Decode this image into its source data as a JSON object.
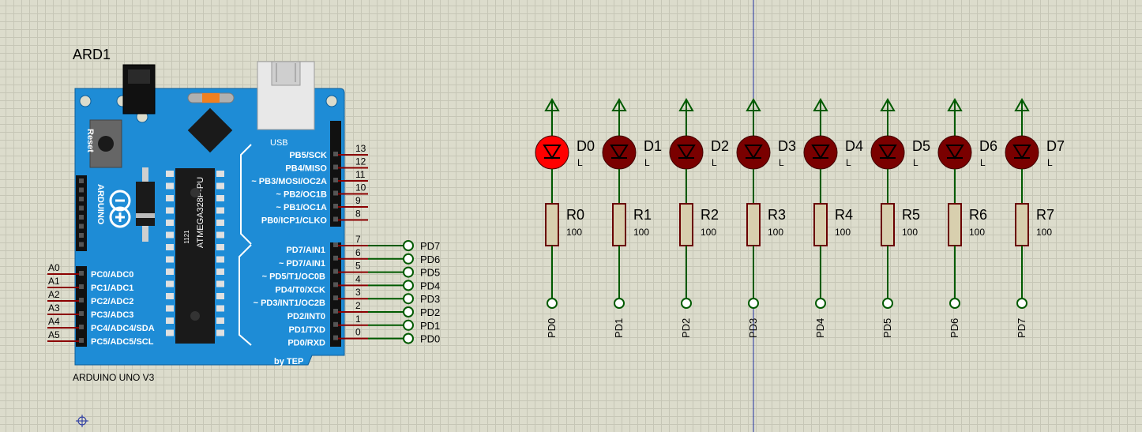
{
  "arduino": {
    "ref": "ARD1",
    "name": "ARDUINO UNO V3",
    "usb_label": "USB",
    "reset_label": "Reset",
    "logo_text": "ARDUINO",
    "chip_label": "ATMEGA328P-PU",
    "chip_code": "1121",
    "by_label": "by TEP",
    "digital_upper": [
      {
        "num": "13",
        "label": "PB5/SCK"
      },
      {
        "num": "12",
        "label": "PB4/MISO"
      },
      {
        "num": "11",
        "label": "~ PB3/MOSI/OC2A"
      },
      {
        "num": "10",
        "label": "~ PB2/OC1B"
      },
      {
        "num": "9",
        "label": "~ PB1/OC1A"
      },
      {
        "num": "8",
        "label": "PB0/ICP1/CLKO"
      }
    ],
    "digital_lower": [
      {
        "num": "7",
        "label": "PD7/AIN1"
      },
      {
        "num": "6",
        "label": "~ PD7/AIN1"
      },
      {
        "num": "5",
        "label": "~ PD5/T1/OC0B"
      },
      {
        "num": "4",
        "label": "PD4/T0/XCK"
      },
      {
        "num": "3",
        "label": "~ PD3/INT1/OC2B"
      },
      {
        "num": "2",
        "label": "PD2/INT0"
      },
      {
        "num": "1",
        "label": "PD1/TXD"
      },
      {
        "num": "0",
        "label": "PD0/RXD"
      }
    ],
    "analog": [
      {
        "ext": "A0",
        "label": "PC0/ADC0"
      },
      {
        "ext": "A1",
        "label": "PC1/ADC1"
      },
      {
        "ext": "A2",
        "label": "PC2/ADC2"
      },
      {
        "ext": "A3",
        "label": "PC3/ADC3"
      },
      {
        "ext": "A4",
        "label": "PC4/ADC4/SDA"
      },
      {
        "ext": "A5",
        "label": "PC5/ADC5/SCL"
      }
    ]
  },
  "board_terminals": [
    "PD7",
    "PD6",
    "PD5",
    "PD4",
    "PD3",
    "PD2",
    "PD1",
    "PD0"
  ],
  "leds": [
    {
      "ref": "D0",
      "type": "L",
      "resistor": "R0",
      "value": "100",
      "net": "PD0",
      "lit": true
    },
    {
      "ref": "D1",
      "type": "L",
      "resistor": "R1",
      "value": "100",
      "net": "PD1",
      "lit": false
    },
    {
      "ref": "D2",
      "type": "L",
      "resistor": "R2",
      "value": "100",
      "net": "PD2",
      "lit": false
    },
    {
      "ref": "D3",
      "type": "L",
      "resistor": "R3",
      "value": "100",
      "net": "PD3",
      "lit": false
    },
    {
      "ref": "D4",
      "type": "L",
      "resistor": "R4",
      "value": "100",
      "net": "PD4",
      "lit": false
    },
    {
      "ref": "D5",
      "type": "L",
      "resistor": "R5",
      "value": "100",
      "net": "PD5",
      "lit": false
    },
    {
      "ref": "D6",
      "type": "L",
      "resistor": "R6",
      "value": "100",
      "net": "PD6",
      "lit": false
    },
    {
      "ref": "D7",
      "type": "L",
      "resistor": "R7",
      "value": "100",
      "net": "PD7",
      "lit": false
    }
  ],
  "colors": {
    "board_blue": "#1e8cd6",
    "wire_green": "#005a00",
    "pin_red": "#8b0000",
    "led_lit": "#ff0000",
    "led_off": "#7a0000",
    "resistor_body": "#d8cfae",
    "axis_line": "#2030a0"
  }
}
